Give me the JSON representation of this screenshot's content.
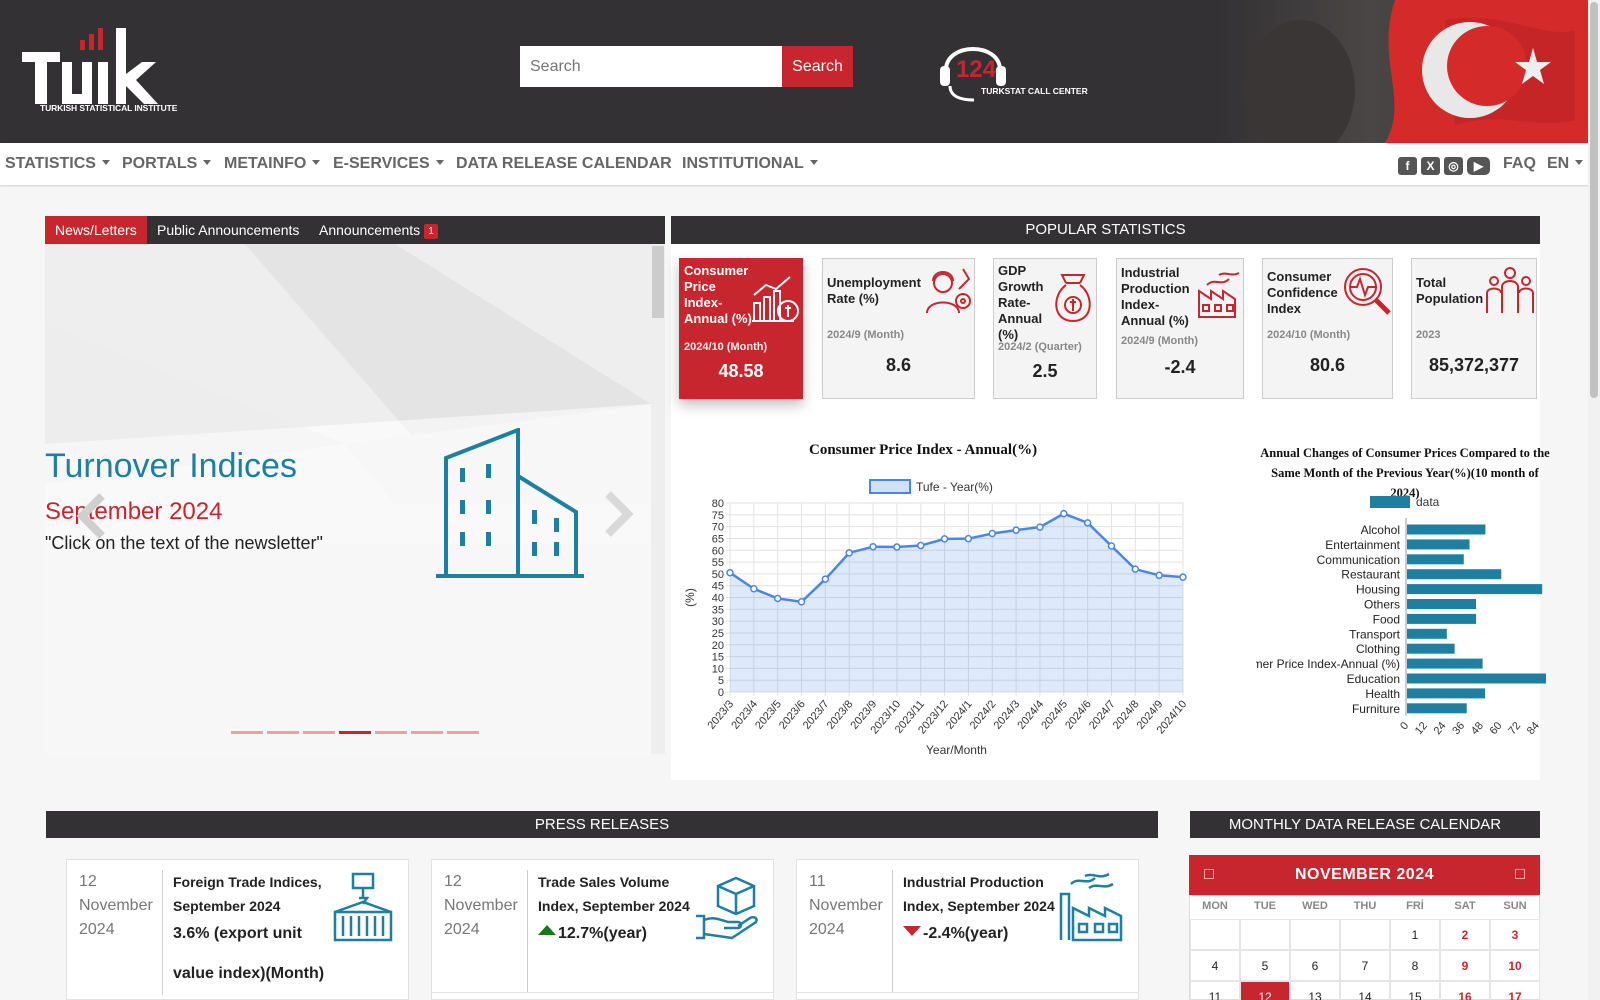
{
  "header": {
    "logo_text": "TURKISH STATISTICAL INSTITUTE",
    "search_placeholder": "Search",
    "search_button": "Search",
    "callcenter_number": "124",
    "callcenter_label": "TURKSTAT CALL CENTER"
  },
  "nav": {
    "items": [
      "STATISTICS",
      "PORTALS",
      "METAINFO",
      "E-SERVICES",
      "DATA RELEASE CALENDAR",
      "INSTITUTIONAL"
    ],
    "faq": "FAQ",
    "lang": "EN",
    "social": [
      "facebook-icon",
      "x-icon",
      "instagram-icon",
      "youtube-icon"
    ]
  },
  "news": {
    "tabs": [
      "News/Letters",
      "Public Announcements",
      "Announcements"
    ],
    "announcement_badge": "1",
    "slide_title": "Turnover Indices",
    "slide_subtitle": "September 2024",
    "slide_text": "\"Click on the text of the newsletter\""
  },
  "popular": {
    "header": "POPULAR STATISTICS",
    "cards": [
      {
        "title": "Consumer Price Index-Annual (%)",
        "period": "2024/10 (Month)",
        "value": "48.58"
      },
      {
        "title": "Unemployment Rate (%)",
        "period": "2024/9 (Month)",
        "value": "8.6"
      },
      {
        "title": "GDP Growth Rate-Annual (%)",
        "period": "2024/2 (Quarter)",
        "value": "2.5"
      },
      {
        "title": "Industrial Production Index-Annual (%)",
        "period": "2024/9 (Month)",
        "value": "-2.4"
      },
      {
        "title": "Consumer Confidence Index",
        "period": "2024/10 (Month)",
        "value": "80.6"
      },
      {
        "title": "Total Population",
        "period": "2023",
        "value": "85,372,377"
      }
    ]
  },
  "chart_data": [
    {
      "type": "area",
      "title": "Consumer Price Index - Annual(%)",
      "xlabel": "Year/Month",
      "ylabel": "(%)",
      "ylim": [
        0,
        80
      ],
      "grid": true,
      "legend": "top",
      "categories": [
        "2023/3",
        "2023/4",
        "2023/5",
        "2023/6",
        "2023/7",
        "2023/8",
        "2023/9",
        "2023/10",
        "2023/11",
        "2023/12",
        "2024/1",
        "2024/2",
        "2024/3",
        "2024/4",
        "2024/5",
        "2024/6",
        "2024/7",
        "2024/8",
        "2024/9",
        "2024/10"
      ],
      "series": [
        {
          "name": "Tufe - Year(%)",
          "values": [
            50.5,
            43.7,
            39.6,
            38.2,
            47.8,
            58.9,
            61.5,
            61.4,
            62.0,
            64.8,
            64.9,
            67.1,
            68.5,
            69.8,
            75.5,
            71.6,
            61.8,
            52.0,
            49.4,
            48.6
          ]
        }
      ]
    },
    {
      "type": "bar",
      "orientation": "horizontal",
      "title": "Annual Changes of Consumer Prices Compared to the Same Month of the Previous Year(%)(10 month of 2024)",
      "legend": "top",
      "xlim": [
        0,
        90
      ],
      "xticks": [
        "0",
        "12",
        "24",
        "36",
        "48",
        "60",
        "72",
        "84"
      ],
      "categories": [
        "Alcohol",
        "Entertainment",
        "Communication",
        "Restaurant",
        "Housing",
        "Others",
        "Food",
        "Transport",
        "Clothing",
        "Consumer Price Index-Annual (%)",
        "Education",
        "Health",
        "Furniture"
      ],
      "series": [
        {
          "name": "data",
          "values": [
            50.4,
            40.2,
            36.5,
            60.6,
            86.9,
            44.4,
            44.4,
            25.6,
            30.6,
            48.6,
            91.6,
            50.2,
            38.4
          ]
        }
      ]
    }
  ],
  "press": {
    "header": "PRESS RELEASES",
    "items": [
      {
        "date": "12 November 2024",
        "title": "Foreign Trade Indices, September 2024",
        "value": "3.6% (export unit value index)(Month)"
      },
      {
        "date": "12 November 2024",
        "title": "Trade Sales Volume Index, September 2024",
        "value": "12.7%(year)",
        "trend": "up"
      },
      {
        "date": "11 November 2024",
        "title": "Industrial Production Index, September 2024",
        "value": "-2.4%(year)",
        "trend": "down"
      }
    ]
  },
  "calendar": {
    "header": "MONTHLY DATA RELEASE CALENDAR",
    "month": "NOVEMBER 2024",
    "days_of_week": [
      "MON",
      "TUE",
      "WED",
      "THU",
      "FRİ",
      "SAT",
      "SUN"
    ],
    "weeks": [
      [
        "",
        "",
        "",
        "",
        "1",
        "2",
        "3"
      ],
      [
        "4",
        "5",
        "6",
        "7",
        "8",
        "9",
        "10"
      ],
      [
        "11",
        "12",
        "13",
        "14",
        "15",
        "16",
        "17"
      ]
    ],
    "today": "12"
  },
  "colors": {
    "brand_red": "#c8262f",
    "dark": "#333133",
    "teal": "#1e7fa0",
    "chart_line": "#4a86e8"
  }
}
